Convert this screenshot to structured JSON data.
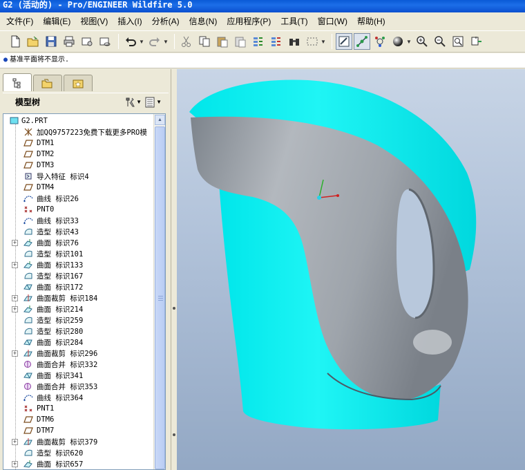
{
  "window": {
    "title": "G2 (活动的) - Pro/ENGINEER Wildfire 5.0"
  },
  "menu": [
    "文件(F)",
    "编辑(E)",
    "视图(V)",
    "插入(I)",
    "分析(A)",
    "信息(N)",
    "应用程序(P)",
    "工具(T)",
    "窗口(W)",
    "帮助(H)"
  ],
  "message": "基准平面将不显示.",
  "model_tree": {
    "title": "模型树",
    "items": [
      {
        "label": "G2.PRT",
        "icon": "part-icon",
        "expand": false,
        "root": true
      },
      {
        "label": "加QQ9757223免费下载更多PRO模",
        "icon": "csys-icon",
        "expand": false
      },
      {
        "label": "DTM1",
        "icon": "datum-plane-icon",
        "expand": false
      },
      {
        "label": "DTM2",
        "icon": "datum-plane-icon",
        "expand": false
      },
      {
        "label": "DTM3",
        "icon": "datum-plane-icon",
        "expand": false
      },
      {
        "label": "导入特征 标识4",
        "icon": "import-icon",
        "expand": false
      },
      {
        "label": "DTM4",
        "icon": "datum-plane-icon",
        "expand": false
      },
      {
        "label": "曲线 标识26",
        "icon": "curve-icon",
        "expand": false
      },
      {
        "label": "PNT0",
        "icon": "point-icon",
        "expand": false
      },
      {
        "label": "曲线 标识33",
        "icon": "curve-icon",
        "expand": false
      },
      {
        "label": "造型 标识43",
        "icon": "style-icon",
        "expand": false
      },
      {
        "label": "曲面 标识76",
        "icon": "surface-icon",
        "expand": true
      },
      {
        "label": "造型 标识101",
        "icon": "style-icon",
        "expand": false
      },
      {
        "label": "曲面 标识133",
        "icon": "surface-icon",
        "expand": true
      },
      {
        "label": "造型 标识167",
        "icon": "style-icon",
        "expand": false
      },
      {
        "label": "曲面 标识172",
        "icon": "boundary-surface-icon",
        "expand": false
      },
      {
        "label": "曲面裁剪 标识184",
        "icon": "trim-icon",
        "expand": true
      },
      {
        "label": "曲面 标识214",
        "icon": "surface-icon",
        "expand": true
      },
      {
        "label": "造型 标识259",
        "icon": "style-icon",
        "expand": false
      },
      {
        "label": "造型 标识280",
        "icon": "style-icon",
        "expand": false
      },
      {
        "label": "曲面 标识284",
        "icon": "boundary-surface-icon",
        "expand": false
      },
      {
        "label": "曲面裁剪 标识296",
        "icon": "trim-icon",
        "expand": true
      },
      {
        "label": "曲面合并 标识332",
        "icon": "merge-icon",
        "expand": false
      },
      {
        "label": "曲面 标识341",
        "icon": "boundary-surface-icon",
        "expand": false
      },
      {
        "label": "曲面合并 标识353",
        "icon": "merge-icon",
        "expand": false
      },
      {
        "label": "曲线 标识364",
        "icon": "curve-icon",
        "expand": false
      },
      {
        "label": "PNT1",
        "icon": "point-icon",
        "expand": false
      },
      {
        "label": "DTM6",
        "icon": "datum-plane-icon",
        "expand": false
      },
      {
        "label": "DTM7",
        "icon": "datum-plane-icon",
        "expand": false
      },
      {
        "label": "曲面裁剪 标识379",
        "icon": "trim-icon",
        "expand": true
      },
      {
        "label": "造型 标识620",
        "icon": "style-icon",
        "expand": false
      },
      {
        "label": "曲面 标识657",
        "icon": "surface-icon",
        "expand": true
      }
    ]
  },
  "colors": {
    "body_cyan": "#00f0f0",
    "handle_gray": "#9aa0a8",
    "viewport_top": "#c8d5e6",
    "viewport_bottom": "#93a8c4"
  }
}
